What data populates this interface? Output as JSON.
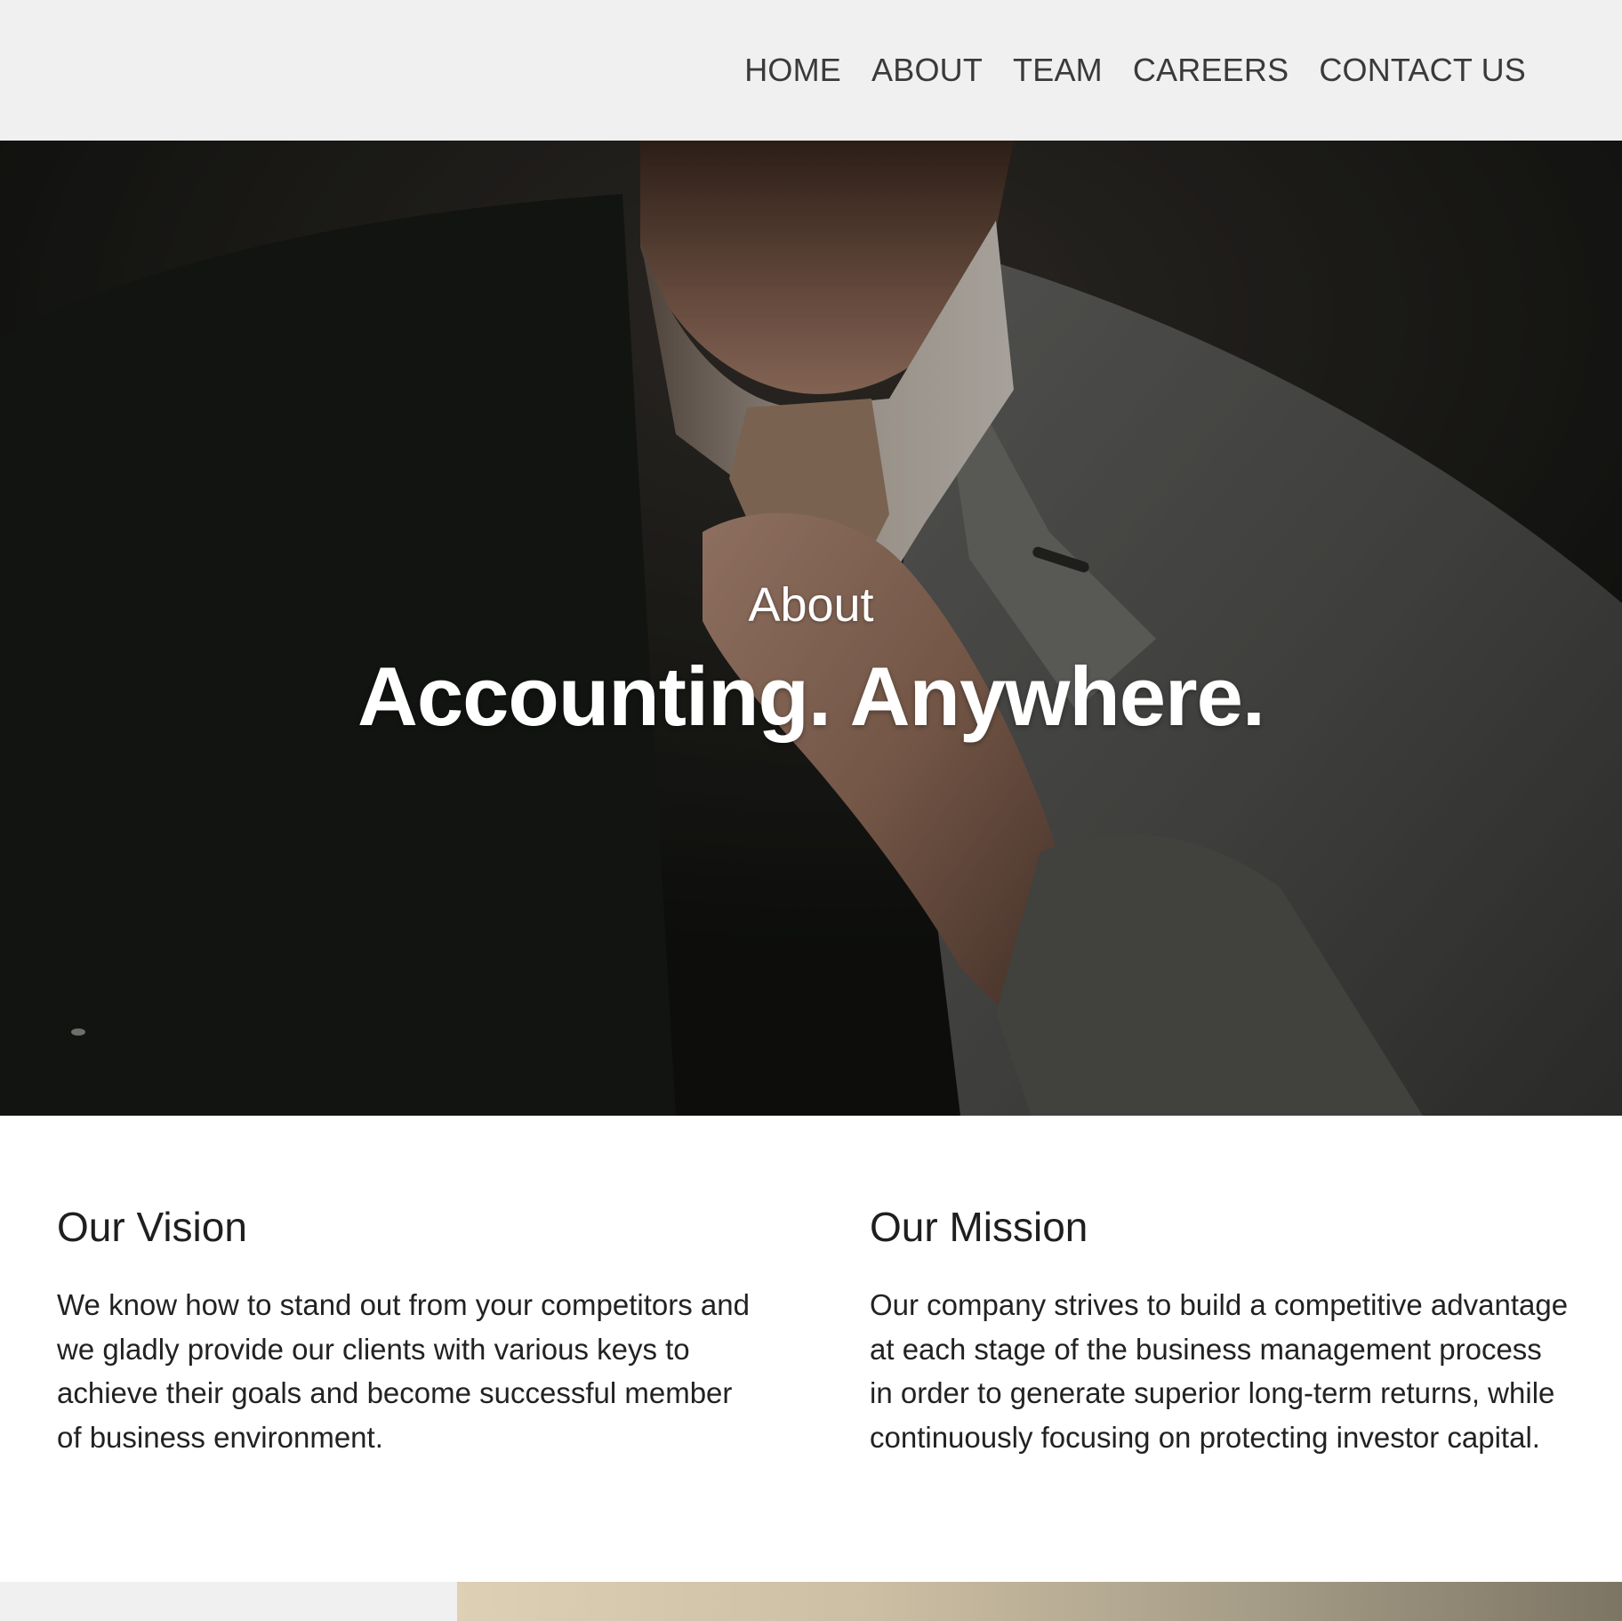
{
  "nav": {
    "items": [
      {
        "label": "HOME"
      },
      {
        "label": "ABOUT"
      },
      {
        "label": "TEAM"
      },
      {
        "label": "CAREERS"
      },
      {
        "label": "CONTACT US"
      }
    ]
  },
  "hero": {
    "kicker": "About",
    "title": "Accounting. Anywhere."
  },
  "vision": {
    "heading": "Our Vision",
    "body": "We know how to stand out from your competitors and we gladly provide our clients with various keys to achieve their goals and become successful member of business environment."
  },
  "mission": {
    "heading": "Our Mission",
    "body": "Our company strives to build a competitive advantage at each stage of the business management process in order to generate superior long-term returns, while continuously focusing on protecting investor capital."
  },
  "colors": {
    "header_bg": "#f0f0f0",
    "nav_text": "#3a3a3a",
    "hero_text": "#ffffff",
    "body_text": "#222222"
  }
}
